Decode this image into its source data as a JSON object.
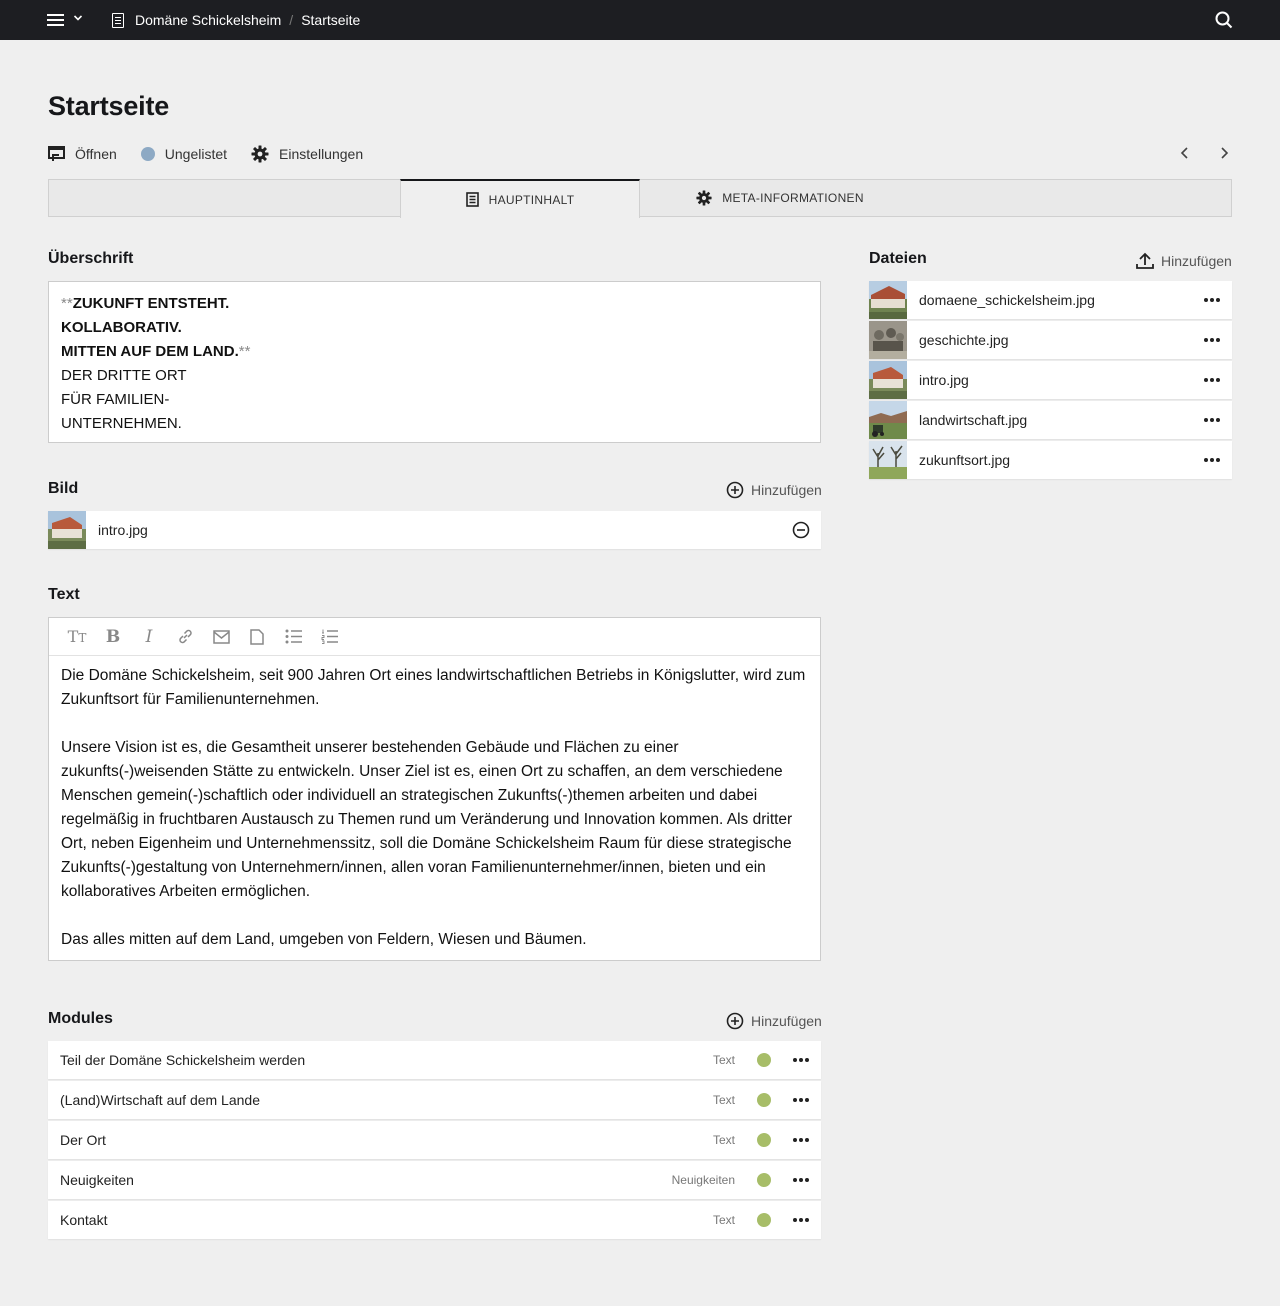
{
  "breadcrumb": {
    "site": "Domäne Schickelsheim",
    "separator": "/",
    "page": "Startseite"
  },
  "page": {
    "title": "Startseite",
    "actions": {
      "open": "Öffnen",
      "status": "Ungelistet",
      "settings": "Einstellungen"
    }
  },
  "tabs": {
    "main": "HAUPTINHALT",
    "meta": "META-INFORMATIONEN"
  },
  "heading_field": {
    "label": "Überschrift",
    "markup": "**",
    "bold_lines": [
      "ZUKUNFT ENTSTEHT.",
      "KOLLABORATIV.",
      "MITTEN AUF DEM LAND."
    ],
    "normal_lines": [
      "DER DRITTE ORT",
      "FÜR FAMILIEN-",
      "UNTERNEHMEN."
    ]
  },
  "image_field": {
    "label": "Bild",
    "add_label": "Hinzufügen",
    "file": "intro.jpg"
  },
  "text_field": {
    "label": "Text",
    "paragraphs": [
      "Die Domäne Schickelsheim, seit 900 Jahren Ort eines landwirtschaftlichen Betriebs in Königslutter, wird zum Zukunftsort für Familienunternehmen.",
      "Unsere Vision ist es, die Gesamtheit unserer bestehenden Gebäude und Flächen zu einer zukunfts(-)weisenden Stätte zu entwickeln. Unser Ziel ist es, einen Ort zu schaffen, an dem verschiedene Menschen gemein(-)schaftlich oder individuell an strategischen Zukunfts(-)themen arbeiten und dabei regelmäßig in fruchtbaren Austausch zu Themen rund um Veränderung und Innovation kommen. Als dritter Ort, neben Eigenheim und Unternehmenssitz, soll die Domäne Schickelsheim Raum für diese strategische Zukunfts(-)gestaltung von Unternehmern/innen, allen voran Familienunternehmer/innen, bieten und ein kollaboratives Arbeiten ermöglichen.",
      "Das alles mitten auf dem Land, umgeben von Feldern, Wiesen und Bäumen."
    ]
  },
  "modules": {
    "label": "Modules",
    "add_label": "Hinzufügen",
    "items": [
      {
        "title": "Teil der Domäne Schickelsheim werden",
        "type": "Text"
      },
      {
        "title": "(Land)Wirtschaft auf dem Lande",
        "type": "Text"
      },
      {
        "title": "Der Ort",
        "type": "Text"
      },
      {
        "title": "Neuigkeiten",
        "type": "Neuigkeiten"
      },
      {
        "title": "Kontakt",
        "type": "Text"
      }
    ]
  },
  "files": {
    "label": "Dateien",
    "add_label": "Hinzufügen",
    "items": [
      {
        "name": "domaene_schickelsheim.jpg"
      },
      {
        "name": "geschichte.jpg"
      },
      {
        "name": "intro.jpg"
      },
      {
        "name": "landwirtschaft.jpg"
      },
      {
        "name": "zukunftsort.jpg"
      }
    ]
  },
  "colors": {
    "topbar": "#1d1e22",
    "background": "#efefef",
    "status_unlisted": "#8da9c4",
    "status_listed": "#a7bd68"
  },
  "icons": [
    "menu-icon",
    "chevron-down-icon",
    "page-icon",
    "search-icon",
    "open-icon",
    "gear-icon",
    "chevron-left-icon",
    "chevron-right-icon",
    "add-circle-icon",
    "remove-circle-icon",
    "upload-icon",
    "more-icon"
  ]
}
